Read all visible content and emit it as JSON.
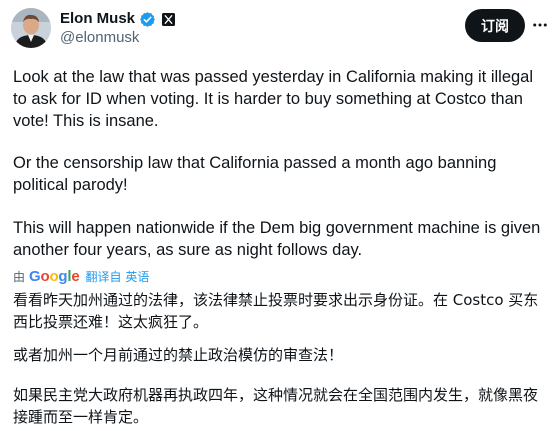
{
  "author": {
    "display_name": "Elon Musk",
    "handle": "@elonmusk",
    "avatar_icon": "profile-photo",
    "verified_icon": "verified-badge-icon",
    "affiliation_icon": "x-logo-icon"
  },
  "actions": {
    "follow_label": "订阅",
    "more_icon": "more-icon"
  },
  "colors": {
    "verified": "#1d9bf0",
    "follow_bg": "#0f1419",
    "link": "#1d9bf0",
    "secondary_text": "#536471"
  },
  "post": {
    "paragraphs": [
      "Look at the law that was passed yesterday in California making it illegal to ask for ID when voting. It is harder to buy something at Costco than vote! This is insane.",
      "Or the censorship law that California passed a month ago banning political parody!",
      "This will happen nationwide if the Dem big government machine is given another four years, as sure as night follows day."
    ]
  },
  "translation": {
    "by_label": "由",
    "provider": "Google",
    "link_label": "翻译自 英语",
    "paragraphs": [
      "看看昨天加州通过的法律，该法律禁止投票时要求出示身份证。在 Costco 买东西比投票还难！这太疯狂了。",
      "或者加州一个月前通过的禁止政治模仿的审查法！",
      "如果民主党大政府机器再执政四年，这种情况就会在全国范围内发生，就像黑夜接踵而至一样肯定。"
    ]
  }
}
